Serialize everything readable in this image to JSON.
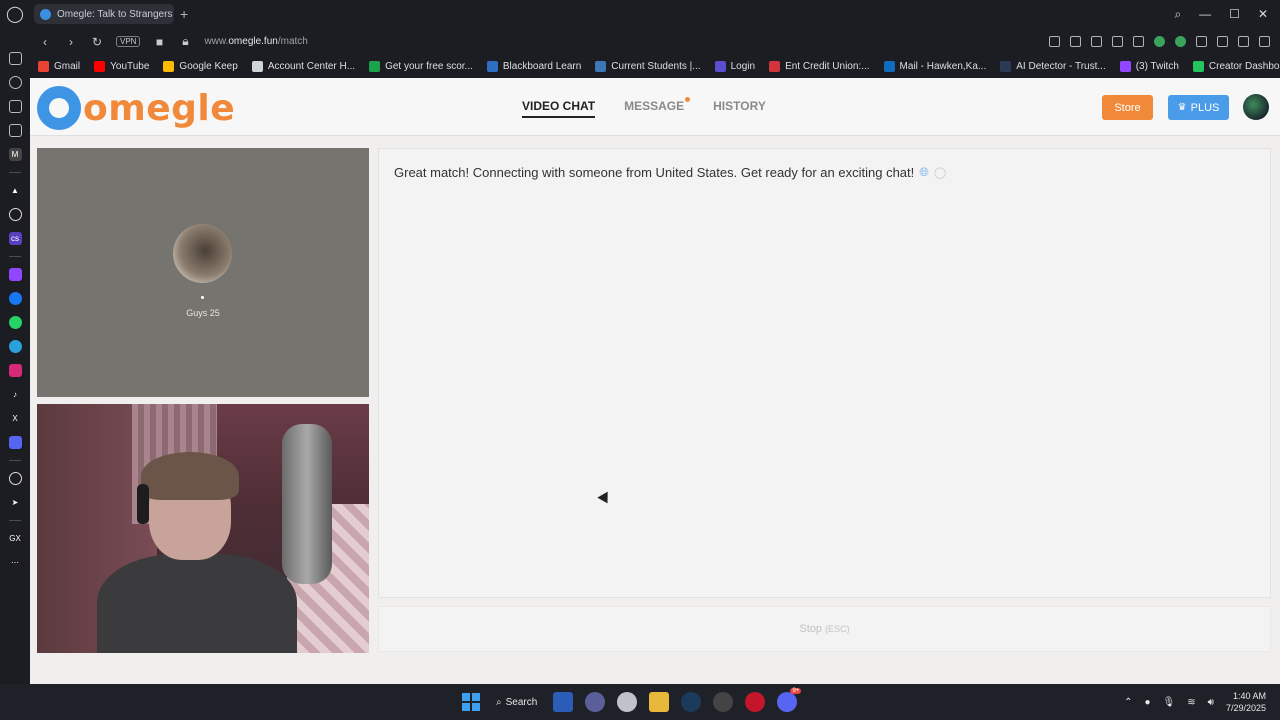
{
  "browser": {
    "tab_title": "Omegle: Talk to Strangers",
    "tab_close": "✕",
    "new_tab": "+",
    "url_prefix": "www.",
    "url_domain": "omegle.fun",
    "url_path": "/match",
    "vpn_label": "VPN",
    "bookmarks": [
      {
        "label": "Gmail",
        "color": "#ea4335"
      },
      {
        "label": "YouTube",
        "color": "#ff0000"
      },
      {
        "label": "Google Keep",
        "color": "#f9bb05"
      },
      {
        "label": "Account Center H...",
        "color": "#cfd3da"
      },
      {
        "label": "Get your free scor...",
        "color": "#1aa34a"
      },
      {
        "label": "Blackboard Learn",
        "color": "#2e6fbf"
      },
      {
        "label": "Current Students |...",
        "color": "#3b78b5"
      },
      {
        "label": "Login",
        "color": "#5a4fcf"
      },
      {
        "label": "Ent Credit Union:...",
        "color": "#d1343b"
      },
      {
        "label": "Mail - Hawken,Ka...",
        "color": "#0f6cbd"
      },
      {
        "label": "AI Detector - Trust...",
        "color": "#2b3a55"
      },
      {
        "label": "(3) Twitch",
        "color": "#9146ff"
      },
      {
        "label": "Creator Dashboar...",
        "color": "#22c55e"
      }
    ]
  },
  "site": {
    "logo_text": "omegle",
    "nav": [
      {
        "label": "VIDEO CHAT",
        "active": true
      },
      {
        "label": "MESSAGE",
        "active": false,
        "notify": true
      },
      {
        "label": "HISTORY",
        "active": false
      }
    ],
    "store_label": "Store",
    "plus_label": "PLUS",
    "accent_orange": "#f08a3a",
    "accent_blue": "#4a9be8"
  },
  "stranger": {
    "name": "Guys 25"
  },
  "chat": {
    "message": "Great match! Connecting with someone from United States. Get ready for an exciting chat!",
    "stop_label": "Stop",
    "stop_hint": "(ESC)"
  },
  "taskbar": {
    "search_label": "Search",
    "discord_badge": "9+",
    "time": "1:40 AM",
    "date": "7/29/2025"
  }
}
